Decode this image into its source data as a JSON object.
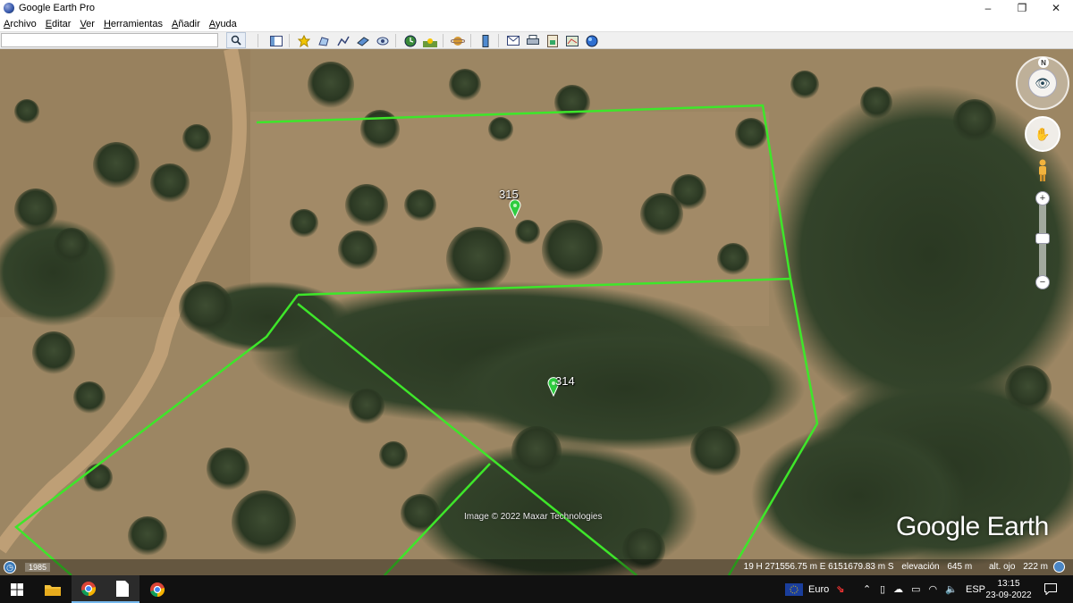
{
  "window": {
    "title": "Google Earth Pro",
    "minimize_glyph": "–",
    "maximize_glyph": "❐",
    "close_glyph": "✕"
  },
  "menu": [
    "Archivo",
    "Editar",
    "Ver",
    "Herramientas",
    "Añadir",
    "Ayuda"
  ],
  "search": {
    "value": "",
    "placeholder": ""
  },
  "toolbar_icons": [
    "hide-sidebar-icon",
    "add-placemark-icon",
    "add-polygon-icon",
    "add-path-icon",
    "add-image-overlay-icon",
    "record-tour-icon",
    "historical-imagery-icon",
    "sunlight-icon",
    "planets-icon",
    "ruler-icon",
    "email-icon",
    "print-icon",
    "save-image-icon",
    "view-in-maps-icon",
    "sky-icon"
  ],
  "map": {
    "placemarks": [
      {
        "label": "315",
        "color": "#2ecc40"
      },
      {
        "label": "314",
        "color": "#2ecc40"
      }
    ],
    "boundary_color": "#3ee62a",
    "attribution": "Image © 2022 Maxar Technologies",
    "brand": "Google Earth",
    "compass_north": "N"
  },
  "status": {
    "year": "1985",
    "coordinates": "19 H 271556.75 m E 6151679.83 m S",
    "elevation_label": "elevación",
    "elevation_value": "645 m",
    "eye_alt_label": "alt. ojo",
    "eye_alt_value": "222 m"
  },
  "taskbar": {
    "apps": [
      "start-button",
      "file-explorer",
      "chrome",
      "google-earth-pro",
      "chrome-profile"
    ],
    "currency_label": "Euro",
    "language": "ESP",
    "time": "13:15",
    "date": "23-09-2022",
    "accent_color": "#76b9ed"
  }
}
